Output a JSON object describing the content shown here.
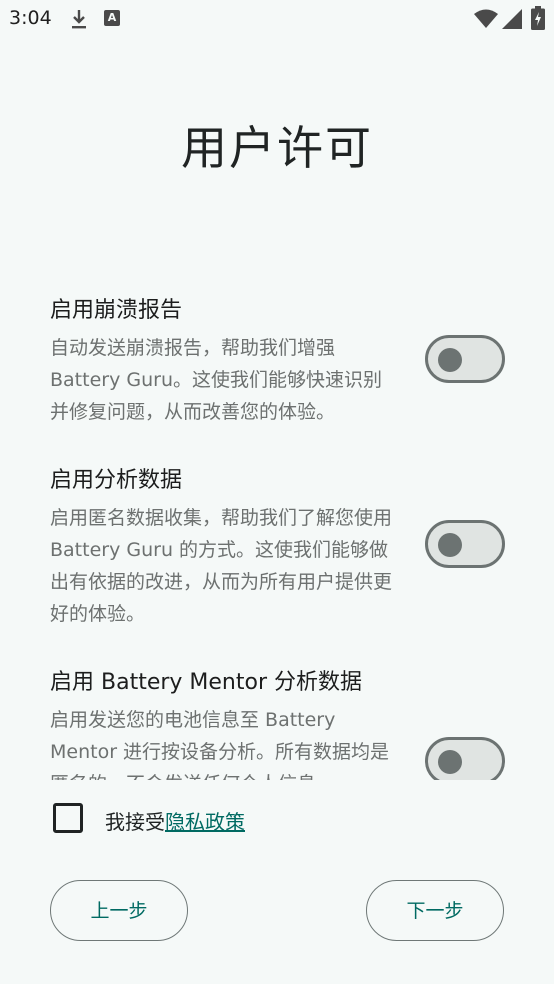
{
  "status_bar": {
    "time": "3:04",
    "icons": [
      "download-icon",
      "a-badge-icon",
      "wifi-icon",
      "signal-icon",
      "battery-icon"
    ],
    "a_badge": "A"
  },
  "page": {
    "title": "用户许可"
  },
  "settings": [
    {
      "title": "启用崩溃报告",
      "description": "自动发送崩溃报告，帮助我们增强 Battery Guru。这使我们能够快速识别并修复问题，从而改善您的体验。",
      "enabled": false
    },
    {
      "title": "启用分析数据",
      "description": "启用匿名数据收集，帮助我们了解您使用 Battery Guru 的方式。这使我们能够做出有依据的改进，从而为所有用户提供更好的体验。",
      "enabled": false
    },
    {
      "title": "启用 Battery Mentor 分析数据",
      "description": "启用发送您的电池信息至 Battery Mentor 进行按设备分析。所有数据均是匿名的，不会发送任何个人信息。",
      "enabled": false
    }
  ],
  "consent": {
    "checked": false,
    "prefix": "我接受",
    "link": "隐私政策"
  },
  "buttons": {
    "previous": "上一步",
    "next": "下一步"
  },
  "colors": {
    "background": "#f5f9f8",
    "accent": "#006a62",
    "toggle_off_track": "#e0e4e2",
    "toggle_off_thumb": "#6c7372",
    "secondary_text": "#6d7170"
  }
}
